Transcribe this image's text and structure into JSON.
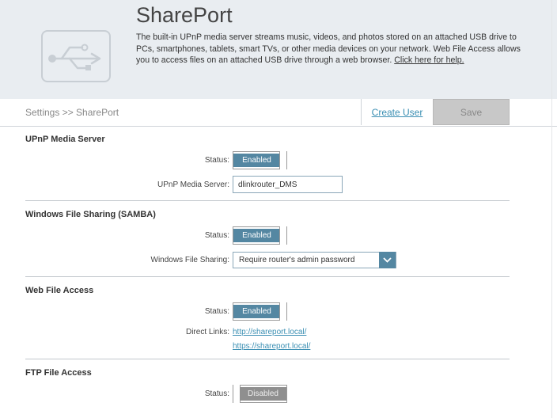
{
  "header": {
    "title": "SharePort",
    "description": "The built-in UPnP media server streams music, videos, and photos stored on an attached USB drive to PCs, smartphones, tablets, smart TVs, or other media devices on your network. Web File Access allows you to access files on an attached USB drive through a web browser. ",
    "help_link": "Click here for help."
  },
  "toolbar": {
    "breadcrumb": "Settings >> SharePort",
    "create_user": "Create User",
    "save": "Save"
  },
  "upnp": {
    "title": "UPnP Media Server",
    "status_label": "Status:",
    "status_value": "Enabled",
    "server_label": "UPnP Media Server:",
    "server_value": "dlinkrouter_DMS"
  },
  "samba": {
    "title": "Windows File Sharing (SAMBA)",
    "status_label": "Status:",
    "status_value": "Enabled",
    "sharing_label": "Windows File Sharing:",
    "sharing_value": "Require router's admin password"
  },
  "web": {
    "title": "Web File Access",
    "status_label": "Status:",
    "status_value": "Enabled",
    "links_label": "Direct Links:",
    "link_http": "http://shareport.local/",
    "link_https": "https://shareport.local/"
  },
  "ftp": {
    "title": "FTP File Access",
    "status_label": "Status:",
    "status_value": "Disabled"
  },
  "colors": {
    "accent": "#5487a2",
    "link": "#3b8fb3",
    "disabled": "#8f8f8f"
  }
}
